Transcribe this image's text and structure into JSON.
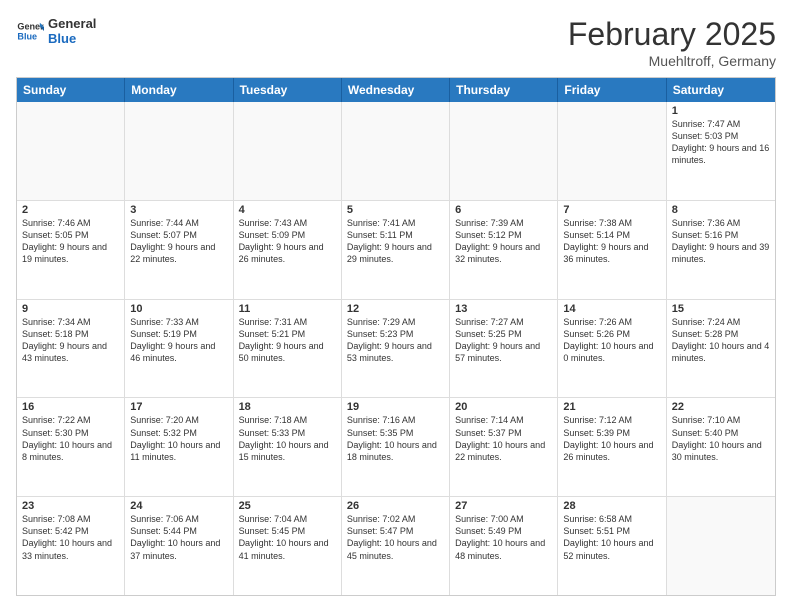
{
  "header": {
    "logo_general": "General",
    "logo_blue": "Blue",
    "month_title": "February 2025",
    "subtitle": "Muehltroff, Germany"
  },
  "calendar": {
    "weekdays": [
      "Sunday",
      "Monday",
      "Tuesday",
      "Wednesday",
      "Thursday",
      "Friday",
      "Saturday"
    ],
    "rows": [
      [
        {
          "day": "",
          "text": ""
        },
        {
          "day": "",
          "text": ""
        },
        {
          "day": "",
          "text": ""
        },
        {
          "day": "",
          "text": ""
        },
        {
          "day": "",
          "text": ""
        },
        {
          "day": "",
          "text": ""
        },
        {
          "day": "1",
          "text": "Sunrise: 7:47 AM\nSunset: 5:03 PM\nDaylight: 9 hours and 16 minutes."
        }
      ],
      [
        {
          "day": "2",
          "text": "Sunrise: 7:46 AM\nSunset: 5:05 PM\nDaylight: 9 hours and 19 minutes."
        },
        {
          "day": "3",
          "text": "Sunrise: 7:44 AM\nSunset: 5:07 PM\nDaylight: 9 hours and 22 minutes."
        },
        {
          "day": "4",
          "text": "Sunrise: 7:43 AM\nSunset: 5:09 PM\nDaylight: 9 hours and 26 minutes."
        },
        {
          "day": "5",
          "text": "Sunrise: 7:41 AM\nSunset: 5:11 PM\nDaylight: 9 hours and 29 minutes."
        },
        {
          "day": "6",
          "text": "Sunrise: 7:39 AM\nSunset: 5:12 PM\nDaylight: 9 hours and 32 minutes."
        },
        {
          "day": "7",
          "text": "Sunrise: 7:38 AM\nSunset: 5:14 PM\nDaylight: 9 hours and 36 minutes."
        },
        {
          "day": "8",
          "text": "Sunrise: 7:36 AM\nSunset: 5:16 PM\nDaylight: 9 hours and 39 minutes."
        }
      ],
      [
        {
          "day": "9",
          "text": "Sunrise: 7:34 AM\nSunset: 5:18 PM\nDaylight: 9 hours and 43 minutes."
        },
        {
          "day": "10",
          "text": "Sunrise: 7:33 AM\nSunset: 5:19 PM\nDaylight: 9 hours and 46 minutes."
        },
        {
          "day": "11",
          "text": "Sunrise: 7:31 AM\nSunset: 5:21 PM\nDaylight: 9 hours and 50 minutes."
        },
        {
          "day": "12",
          "text": "Sunrise: 7:29 AM\nSunset: 5:23 PM\nDaylight: 9 hours and 53 minutes."
        },
        {
          "day": "13",
          "text": "Sunrise: 7:27 AM\nSunset: 5:25 PM\nDaylight: 9 hours and 57 minutes."
        },
        {
          "day": "14",
          "text": "Sunrise: 7:26 AM\nSunset: 5:26 PM\nDaylight: 10 hours and 0 minutes."
        },
        {
          "day": "15",
          "text": "Sunrise: 7:24 AM\nSunset: 5:28 PM\nDaylight: 10 hours and 4 minutes."
        }
      ],
      [
        {
          "day": "16",
          "text": "Sunrise: 7:22 AM\nSunset: 5:30 PM\nDaylight: 10 hours and 8 minutes."
        },
        {
          "day": "17",
          "text": "Sunrise: 7:20 AM\nSunset: 5:32 PM\nDaylight: 10 hours and 11 minutes."
        },
        {
          "day": "18",
          "text": "Sunrise: 7:18 AM\nSunset: 5:33 PM\nDaylight: 10 hours and 15 minutes."
        },
        {
          "day": "19",
          "text": "Sunrise: 7:16 AM\nSunset: 5:35 PM\nDaylight: 10 hours and 18 minutes."
        },
        {
          "day": "20",
          "text": "Sunrise: 7:14 AM\nSunset: 5:37 PM\nDaylight: 10 hours and 22 minutes."
        },
        {
          "day": "21",
          "text": "Sunrise: 7:12 AM\nSunset: 5:39 PM\nDaylight: 10 hours and 26 minutes."
        },
        {
          "day": "22",
          "text": "Sunrise: 7:10 AM\nSunset: 5:40 PM\nDaylight: 10 hours and 30 minutes."
        }
      ],
      [
        {
          "day": "23",
          "text": "Sunrise: 7:08 AM\nSunset: 5:42 PM\nDaylight: 10 hours and 33 minutes."
        },
        {
          "day": "24",
          "text": "Sunrise: 7:06 AM\nSunset: 5:44 PM\nDaylight: 10 hours and 37 minutes."
        },
        {
          "day": "25",
          "text": "Sunrise: 7:04 AM\nSunset: 5:45 PM\nDaylight: 10 hours and 41 minutes."
        },
        {
          "day": "26",
          "text": "Sunrise: 7:02 AM\nSunset: 5:47 PM\nDaylight: 10 hours and 45 minutes."
        },
        {
          "day": "27",
          "text": "Sunrise: 7:00 AM\nSunset: 5:49 PM\nDaylight: 10 hours and 48 minutes."
        },
        {
          "day": "28",
          "text": "Sunrise: 6:58 AM\nSunset: 5:51 PM\nDaylight: 10 hours and 52 minutes."
        },
        {
          "day": "",
          "text": ""
        }
      ]
    ]
  }
}
